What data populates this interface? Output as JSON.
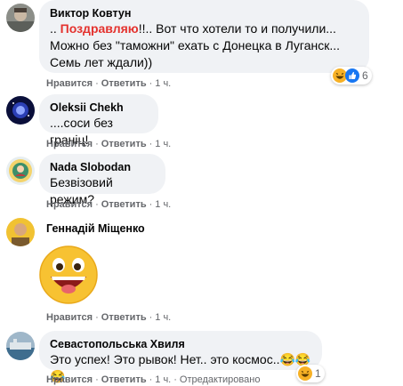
{
  "actions": {
    "like": "Нравится",
    "reply": "Ответить",
    "edited": "Отредактировано"
  },
  "comments": [
    {
      "author": "Виктор Ковтун",
      "text_prefix": "..",
      "text_highlight": "Поздравляю",
      "text_rest": "!!.. Вот что хотели то и получили...",
      "text_line2": "Можно без \"таможни\" ехать с Донецка в Луганск...",
      "text_line3": "Семь лет ждали))",
      "time": "1 ч.",
      "reactions": [
        "haha",
        "like"
      ],
      "reaction_count": "6"
    },
    {
      "author": "Oleksii Chekh",
      "text": "....соси без граніц!",
      "time": "1 ч."
    },
    {
      "author": "Nada Slobodan",
      "text": "Безвізовий режим?",
      "time": "1 ч."
    },
    {
      "author": "Геннадій Міщенко",
      "sticker": "laughing-face",
      "time": "1 ч."
    },
    {
      "author": "Севастопольська Хвиля",
      "text": "Это успех! Это рывок! Нет.. это космос..😂😂😂",
      "time": "1 ч.",
      "reactions": [
        "haha"
      ],
      "reaction_count": "1"
    }
  ],
  "colors": {
    "bubble": "#f0f2f5",
    "meta": "#65676b",
    "highlight": "#e4322e",
    "like": "#1877f2",
    "haha": "#f7b125"
  }
}
